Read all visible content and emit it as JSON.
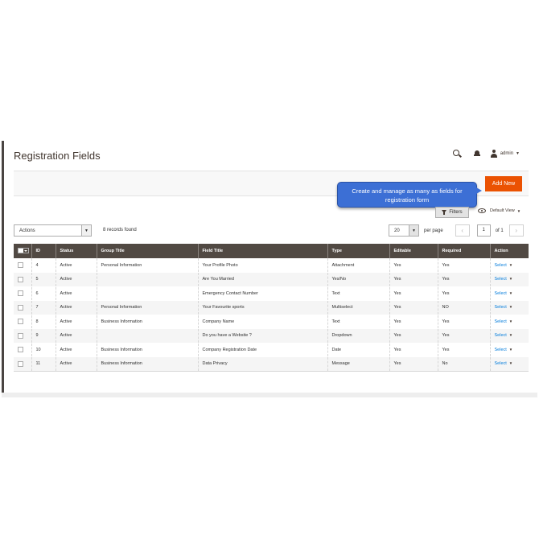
{
  "header": {
    "title": "Registration Fields",
    "user_name": "admin",
    "add_new_label": "Add New"
  },
  "tooltip": {
    "line1": "Create and manage as many as fields for",
    "line2": "registration form"
  },
  "toolbar": {
    "filters_label": "Filters",
    "view_label": "Default View",
    "actions_label": "Actions",
    "records_found": "8 records found",
    "per_page_value": "20",
    "per_page_label": "per page",
    "page_current": "1",
    "page_total": "of 1"
  },
  "grid": {
    "columns": [
      "ID",
      "Status",
      "Group Title",
      "Field Title",
      "Type",
      "Editable",
      "Required",
      "Action"
    ],
    "rows": [
      {
        "id": "4",
        "status": "Active",
        "group": "Personal Information",
        "title": "Your Profile Photo",
        "type": "Attachment",
        "editable": "Yes",
        "required": "Yes",
        "action": "Select"
      },
      {
        "id": "5",
        "status": "Active",
        "group": "",
        "title": "Are You Married",
        "type": "Yes/No",
        "editable": "Yes",
        "required": "Yes",
        "action": "Select"
      },
      {
        "id": "6",
        "status": "Active",
        "group": "",
        "title": "Emergency Contact Number",
        "type": "Text",
        "editable": "Yes",
        "required": "Yes",
        "action": "Select"
      },
      {
        "id": "7",
        "status": "Active",
        "group": "Personal Information",
        "title": "Your Favourite sports",
        "type": "Multiselect",
        "editable": "Yes",
        "required": "NO",
        "action": "Select"
      },
      {
        "id": "8",
        "status": "Active",
        "group": "Business Information",
        "title": "Company Name",
        "type": "Text",
        "editable": "Yes",
        "required": "Yes",
        "action": "Select"
      },
      {
        "id": "9",
        "status": "Active",
        "group": "",
        "title": "Do you have a Website ?",
        "type": "Dropdown",
        "editable": "Yes",
        "required": "Yes",
        "action": "Select"
      },
      {
        "id": "10",
        "status": "Active",
        "group": "Business Information",
        "title": "Company Registration Date",
        "type": "Date",
        "editable": "Yes",
        "required": "Yes",
        "action": "Select"
      },
      {
        "id": "11",
        "status": "Active",
        "group": "Business Information",
        "title": "Data Privacy",
        "type": "Message",
        "editable": "Yes",
        "required": "No",
        "action": "Select"
      }
    ]
  }
}
